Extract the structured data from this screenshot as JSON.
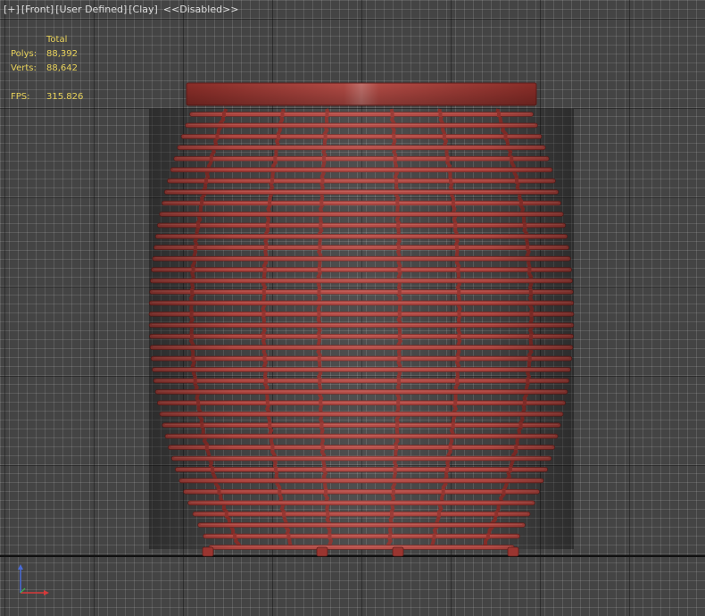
{
  "viewport": {
    "labels": {
      "plus": "[+]",
      "view": "[Front]",
      "lighting": "[User Defined]",
      "shading": "[Clay]",
      "extra": "<<Disabled>>"
    }
  },
  "stats": {
    "header": "Total",
    "polys_label": "Polys:",
    "polys_value": "88,392",
    "verts_label": "Verts:",
    "verts_value": "88,642",
    "fps_label": "FPS:",
    "fps_value": "315.826"
  },
  "colors": {
    "background": "#444444",
    "model": "#b2453f",
    "model_dark": "#7a2a26",
    "stats_text": "#e8d25a"
  },
  "icons": {
    "axis_gizmo": "axis-tripod-icon"
  }
}
